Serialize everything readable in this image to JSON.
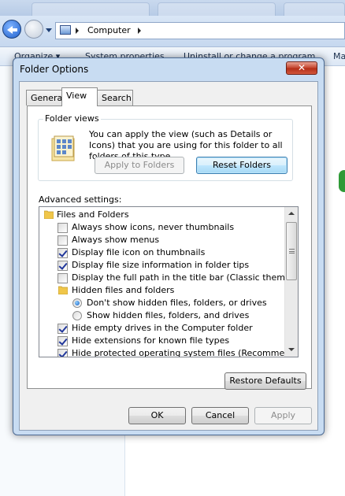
{
  "explorer": {
    "address_path": "Computer",
    "toolbar": {
      "organize": "Organize ▾",
      "system_properties": "System properties",
      "uninstall": "Uninstall or change a program",
      "more": "Ma"
    }
  },
  "dialog": {
    "title": "Folder Options",
    "close_glyph": "✕",
    "tabs": [
      {
        "label": "General",
        "active": false
      },
      {
        "label": "View",
        "active": true
      },
      {
        "label": "Search",
        "active": false
      }
    ],
    "folder_views": {
      "label": "Folder views",
      "description": "You can apply the view (such as Details or Icons) that you are using for this folder to all folders of this type.",
      "apply_button": "Apply to Folders",
      "reset_button": "Reset Folders"
    },
    "advanced_label": "Advanced settings:",
    "advanced_items": [
      {
        "label": "Files and Folders",
        "kind": "folder"
      },
      {
        "label": "Always show icons, never thumbnails",
        "kind": "checkbox",
        "checked": false
      },
      {
        "label": "Always show menus",
        "kind": "checkbox",
        "checked": false
      },
      {
        "label": "Display file icon on thumbnails",
        "kind": "checkbox",
        "checked": true
      },
      {
        "label": "Display file size information in folder tips",
        "kind": "checkbox",
        "checked": true
      },
      {
        "label": "Display the full path in the title bar (Classic theme only)",
        "kind": "checkbox",
        "checked": false
      },
      {
        "label": "Hidden files and folders",
        "kind": "folder"
      },
      {
        "label": "Don't show hidden files, folders, or drives",
        "kind": "radio",
        "checked": true
      },
      {
        "label": "Show hidden files, folders, and drives",
        "kind": "radio",
        "checked": false
      },
      {
        "label": "Hide empty drives in the Computer folder",
        "kind": "checkbox",
        "checked": true
      },
      {
        "label": "Hide extensions for known file types",
        "kind": "checkbox",
        "checked": true
      },
      {
        "label": "Hide protected operating system files (Recommended)",
        "kind": "checkbox",
        "checked": true
      }
    ],
    "restore_defaults": "Restore Defaults",
    "buttons": {
      "ok": "OK",
      "cancel": "Cancel",
      "apply": "Apply"
    }
  }
}
